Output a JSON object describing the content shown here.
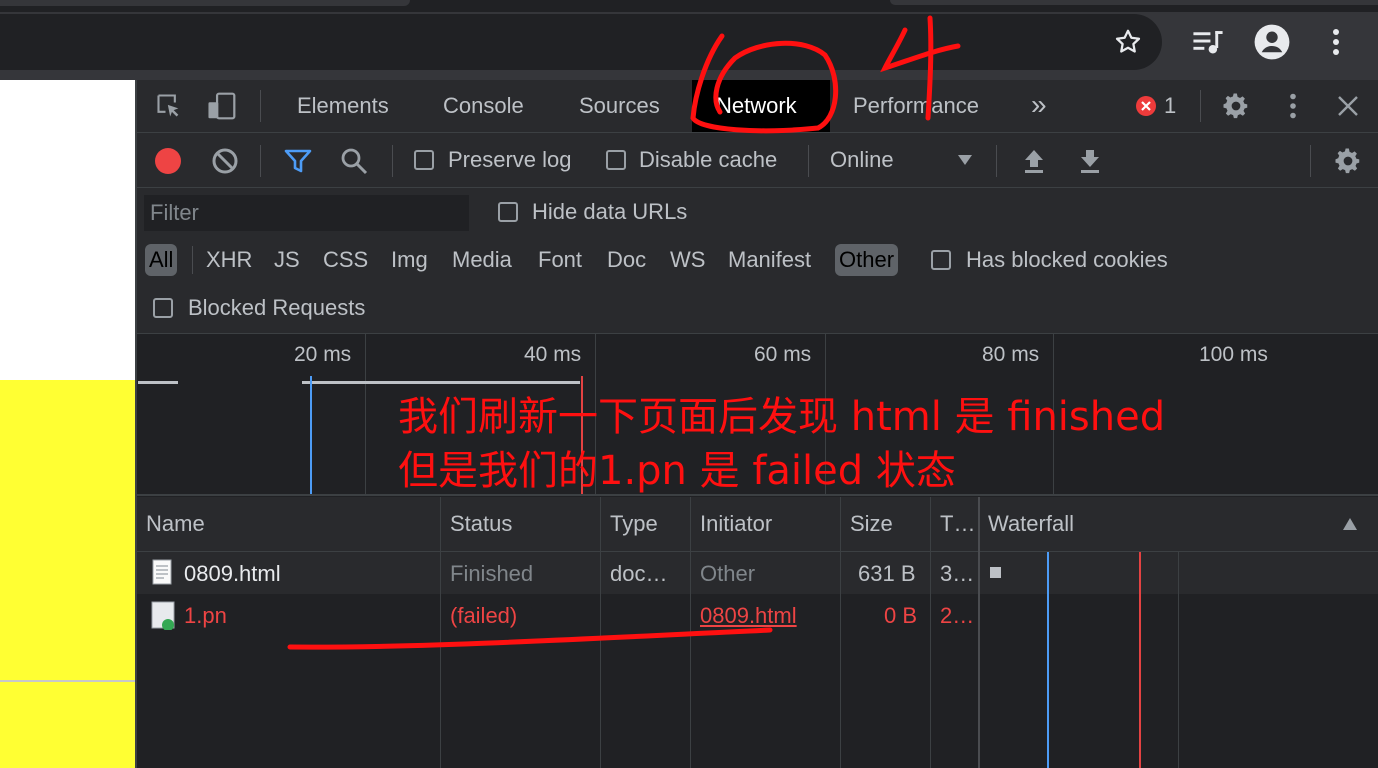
{
  "devtools": {
    "tabs": [
      "Elements",
      "Console",
      "Sources",
      "Network",
      "Performance"
    ],
    "more_tabs": "»",
    "error_count": "1"
  },
  "network_toolbar": {
    "preserve_log": "Preserve log",
    "disable_cache": "Disable cache",
    "throttle": "Online"
  },
  "filter": {
    "placeholder": "Filter",
    "hide_data_urls": "Hide data URLs",
    "types": [
      "All",
      "XHR",
      "JS",
      "CSS",
      "Img",
      "Media",
      "Font",
      "Doc",
      "WS",
      "Manifest",
      "Other"
    ],
    "has_blocked_cookies": "Has blocked cookies",
    "blocked_requests": "Blocked Requests"
  },
  "overview": {
    "ticks": [
      "20 ms",
      "40 ms",
      "60 ms",
      "80 ms",
      "100 ms"
    ]
  },
  "table": {
    "headers": [
      "Name",
      "Status",
      "Type",
      "Initiator",
      "Size",
      "T…",
      "Waterfall"
    ],
    "rows": [
      {
        "name": "0809.html",
        "status": "Finished",
        "type": "doc…",
        "initiator": "Other",
        "size": "631 B",
        "time": "3…"
      },
      {
        "name": "1.pn",
        "status": "(failed)",
        "type": "",
        "initiator": "0809.html",
        "size": "0 B",
        "time": "2…"
      }
    ]
  },
  "annotations": {
    "handwritten": "6 4",
    "note_line1": "我们刷新一下页面后发现 html 是 finished",
    "note_line2": "但是我们的1.pn 是 failed 状态"
  }
}
